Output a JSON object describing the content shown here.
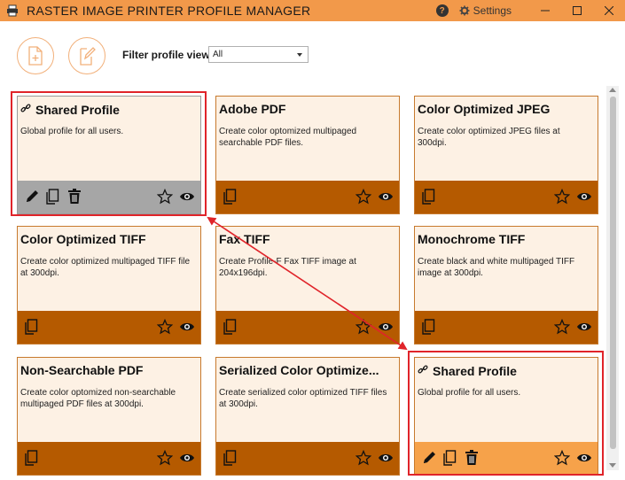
{
  "titlebar": {
    "title": "RASTER IMAGE PRINTER PROFILE MANAGER",
    "help_label": "?",
    "settings_label": "Settings"
  },
  "toolbar": {
    "new_profile_icon": "new-document-icon",
    "edit_profile_icon": "edit-document-icon"
  },
  "filter": {
    "label": "Filter profile views",
    "selected": "All"
  },
  "cards": [
    {
      "title": "Shared Profile",
      "desc": "Global profile for all users.",
      "shared": true
    },
    {
      "title": "Adobe PDF",
      "desc": "Create color optomized multipaged searchable PDF files."
    },
    {
      "title": "Color Optimized JPEG",
      "desc": "Create color optimized JPEG files at 300dpi."
    },
    {
      "title": "Color Optimized TIFF",
      "desc": "Create color optimized multipaged TIFF file at 300dpi."
    },
    {
      "title": "Fax TIFF",
      "desc": "Create Profile-F Fax TIFF image at 204x196dpi."
    },
    {
      "title": "Monochrome TIFF",
      "desc": "Create black and white multipaged TIFF image at 300dpi."
    },
    {
      "title": "Non-Searchable PDF",
      "desc": "Create color optomized non-searchable multipaged PDF files at 300dpi."
    },
    {
      "title": "Serialized Color Optimize...",
      "desc": "Create serialized color optimized TIFF files at 300dpi."
    },
    {
      "title": "Shared Profile",
      "desc": "Global profile for all users.",
      "shared": true
    }
  ],
  "colors": {
    "titlebar": "#f2994a",
    "card_bg": "#fdf1e4",
    "card_bar": "#b55a00",
    "card_bar_selected": "#a6a6a6",
    "card_bar_highlight": "#f6a24a",
    "annotation_red": "#e0242a"
  }
}
